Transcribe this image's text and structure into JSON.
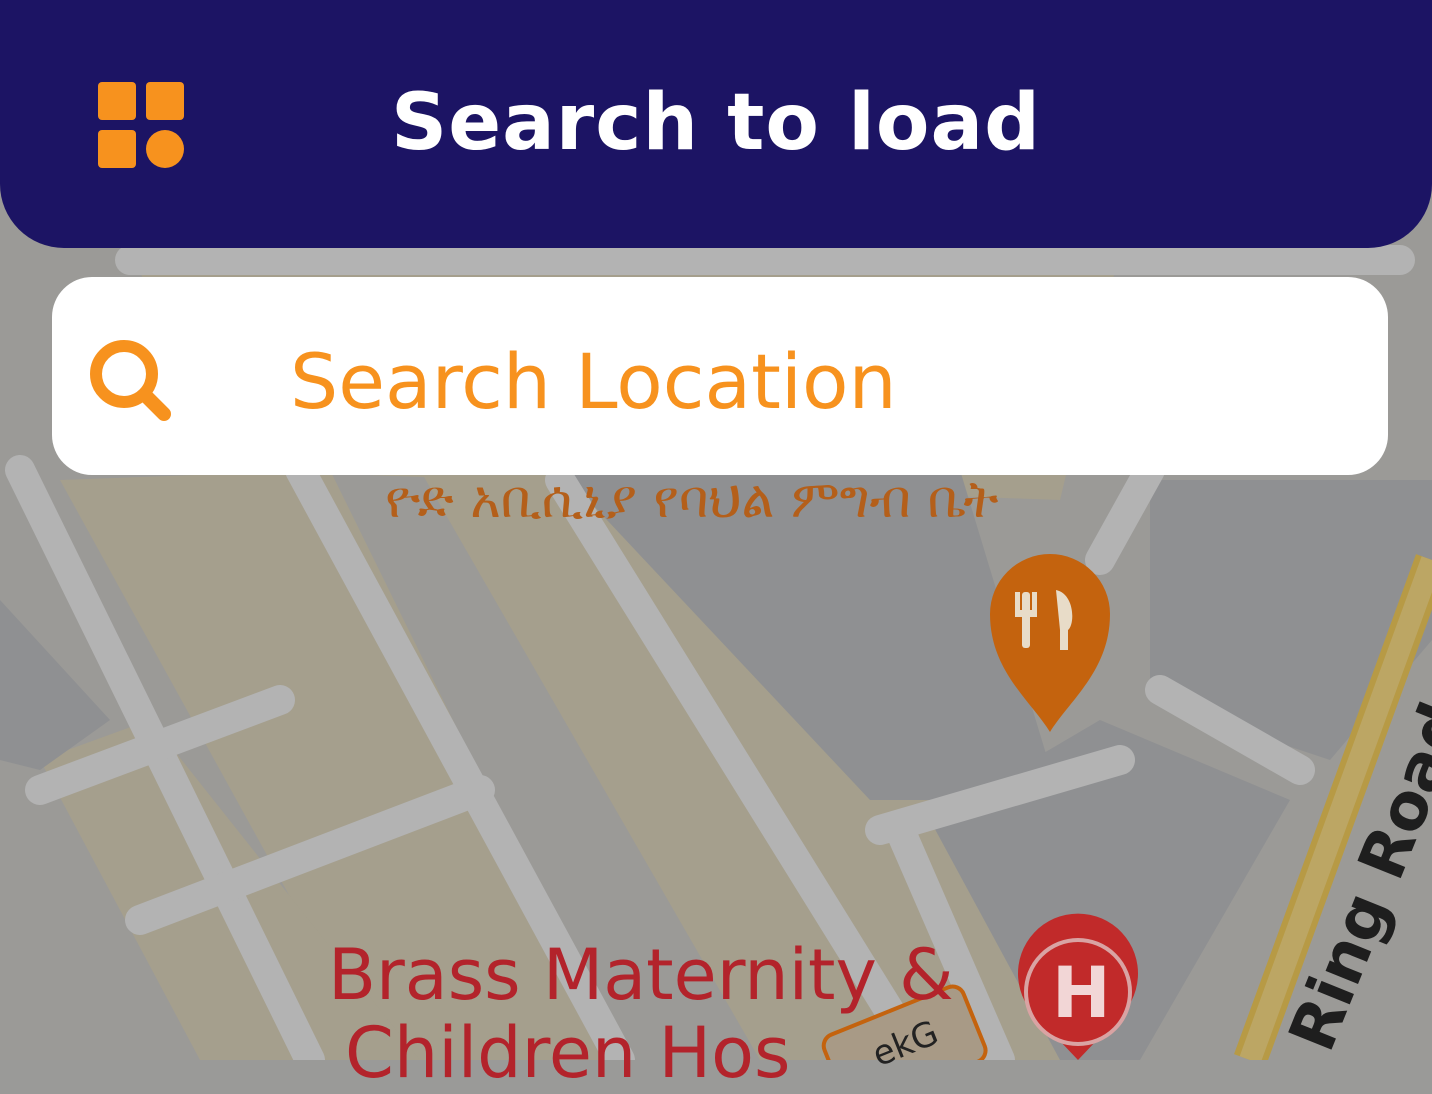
{
  "header": {
    "title": "Search to load",
    "menu_icon": "grid-menu-icon",
    "background_color": "#1c1464",
    "accent_color": "#f7921e"
  },
  "search": {
    "placeholder": "Search Location",
    "value": "",
    "icon": "search-icon"
  },
  "map": {
    "labels": {
      "restaurant": "ዮድ አቢሲኒያ የባህል ምግብ ቤት",
      "hospital_line1": "Brass Maternity &",
      "hospital_line2": "Children Hos",
      "road": "Ring Road",
      "road_shield": "ekG"
    },
    "markers": {
      "restaurant": "restaurant-pin-icon",
      "hospital": "hospital-pin-icon",
      "hospital_letter": "H"
    }
  }
}
